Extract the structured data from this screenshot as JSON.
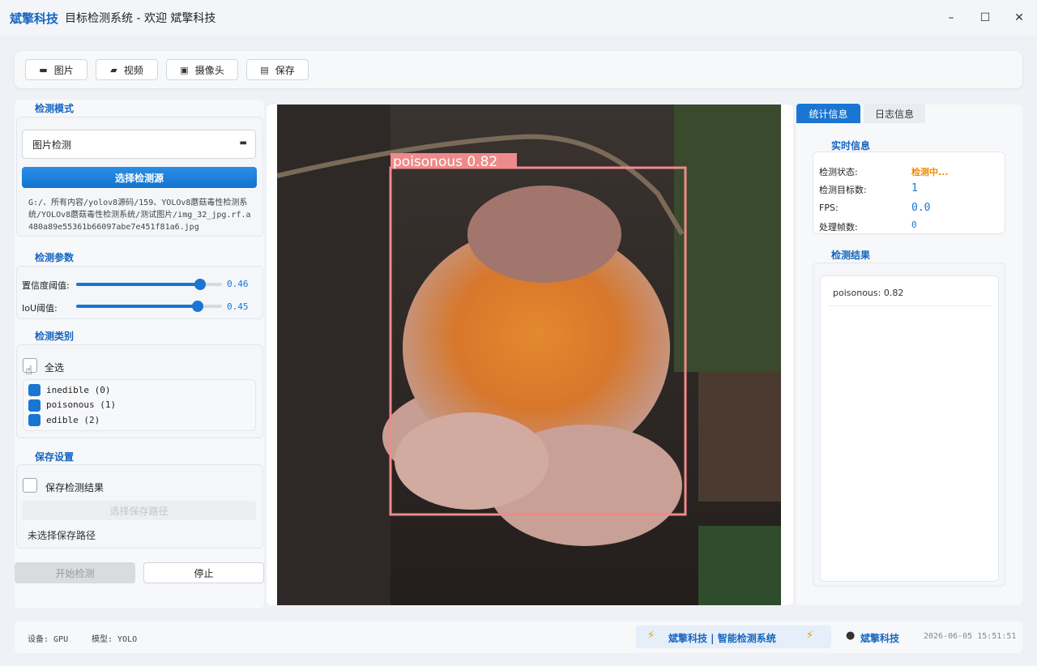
{
  "window": {
    "brand": "斌擎科技",
    "title": "目标检测系统 - 欢迎 斌擎科技",
    "minimize": "–",
    "maximize": "☐",
    "close": "✕"
  },
  "toolbar": {
    "image_label": "图片",
    "video_label": "视频",
    "camera_label": "摄像头",
    "save_label": "保存"
  },
  "detect_mode": {
    "title": "检测模式",
    "selected": "图片检测",
    "choose_source": "选择检测源",
    "path": "G:/、所有内容/yolov8源码/159、YOLOv8蘑菇毒性检测系统/YOLOv8蘑菇毒性检测系统/测试图片/img_32_jpg.rf.a480a89e55361b66097abe7e451f81a6.jpg"
  },
  "params": {
    "title": "检测参数",
    "conf_label": "置信度阈值:",
    "conf_value": "0.46",
    "conf_level": 0.46,
    "iou_label": "IoU阈值:",
    "iou_value": "0.45",
    "iou_level": 0.45
  },
  "classes": {
    "title": "检测类别",
    "select_all": "全选",
    "items": [
      {
        "label": "inedible (0)",
        "checked": true
      },
      {
        "label": "poisonous (1)",
        "checked": true
      },
      {
        "label": "edible (2)",
        "checked": true
      }
    ]
  },
  "save": {
    "title": "保存设置",
    "save_results": "保存检测结果",
    "choose_path": "选择保存路径",
    "no_path": "未选择保存路径"
  },
  "actions": {
    "start": "开始检测",
    "stop": "停止"
  },
  "detection": {
    "label": "poisonous 0.82"
  },
  "right": {
    "tab_stats": "统计信息",
    "tab_log": "日志信息",
    "realtime_title": "实时信息",
    "status_label": "检测状态:",
    "status_value": "检测中...",
    "count_label": "检测目标数:",
    "count_value": "1",
    "fps_label": "FPS:",
    "fps_value": "0.0",
    "frames_label": "处理帧数:",
    "frames_value": "0",
    "results_title": "检测结果",
    "results": [
      "poisonous: 0.82"
    ]
  },
  "statusbar": {
    "device": "设备: GPU",
    "model": "模型: YOLO",
    "banner": "斌擎科技 | 智能检测系统",
    "user": "斌擎科技",
    "datetime": "2026-06-05 15:51:51"
  },
  "colors": {
    "accent": "#1976d2",
    "status_orange": "#f08c00",
    "bbox": "#ef8a8a"
  }
}
